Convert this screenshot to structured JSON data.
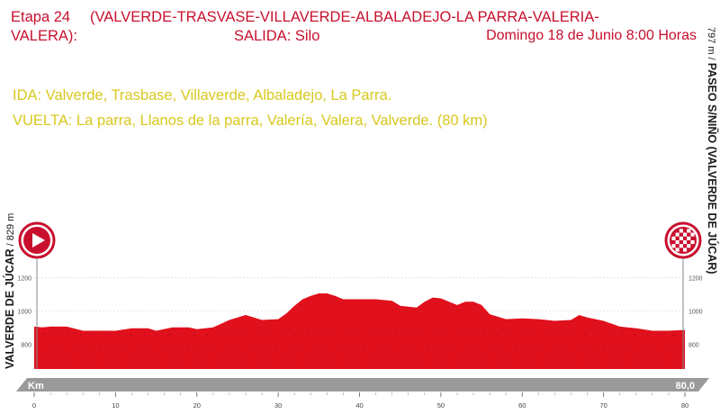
{
  "header": {
    "stage": "Etapa 24",
    "route_part1": "(VALVERDE-TRASVASE-VILLAVERDE-ALBALADEJO-LA PARRA-VALERIA-",
    "route_part2": "VALERA):",
    "start": "SALIDA: Silo",
    "date": "Domingo 18 de Junio 8:00 Horas"
  },
  "route": {
    "outbound": "IDA: Valverde, Trasbase, Villaverde, Albaladejo, La Parra.",
    "return": "VUELTA: La parra, Llanos de la parra, Valería, Valera, Valverde. (80 km)"
  },
  "start_point": {
    "name": "VALVERDE DE JÚCAR",
    "altitude": "829 m"
  },
  "finish_point": {
    "name": "PASEO S/NIÑO (VALVERDE DE JÚCAR)",
    "altitude": "797 m"
  },
  "colors": {
    "profile": "#e0101c",
    "title": "#c8102e",
    "route_text": "#d8c81e",
    "km_bar": "#9a9a9a"
  },
  "icons": {
    "start": "play-arrow-icon",
    "finish": "checkered-flag-icon"
  },
  "chart_data": {
    "type": "area",
    "title": "",
    "xlabel": "Km",
    "ylabel": "",
    "total_label": "80,0",
    "xlim": [
      0,
      80
    ],
    "ylim": [
      650,
      1300
    ],
    "x_ticks": [
      0,
      10,
      20,
      30,
      40,
      50,
      60,
      70,
      80
    ],
    "y_ticks": [
      800,
      1000,
      1200
    ],
    "x": [
      0,
      1,
      2,
      4,
      6,
      8,
      10,
      12,
      14,
      15,
      17,
      19,
      20,
      22,
      24,
      26,
      28,
      30,
      31,
      32,
      33,
      34,
      35,
      36,
      37,
      38,
      40,
      42,
      44,
      45,
      47,
      48,
      49,
      50,
      51,
      52,
      53,
      54,
      55,
      56,
      58,
      60,
      62,
      64,
      66,
      67,
      68,
      70,
      72,
      74,
      76,
      78,
      80
    ],
    "series": [
      {
        "values": [
          905,
          900,
          905,
          905,
          880,
          880,
          880,
          895,
          895,
          880,
          900,
          900,
          890,
          900,
          945,
          975,
          945,
          950,
          985,
          1030,
          1070,
          1090,
          1105,
          1105,
          1090,
          1070,
          1070,
          1070,
          1060,
          1030,
          1020,
          1055,
          1080,
          1075,
          1055,
          1035,
          1055,
          1055,
          1035,
          980,
          950,
          955,
          950,
          940,
          945,
          975,
          960,
          940,
          905,
          895,
          880,
          880,
          885
        ]
      }
    ]
  }
}
